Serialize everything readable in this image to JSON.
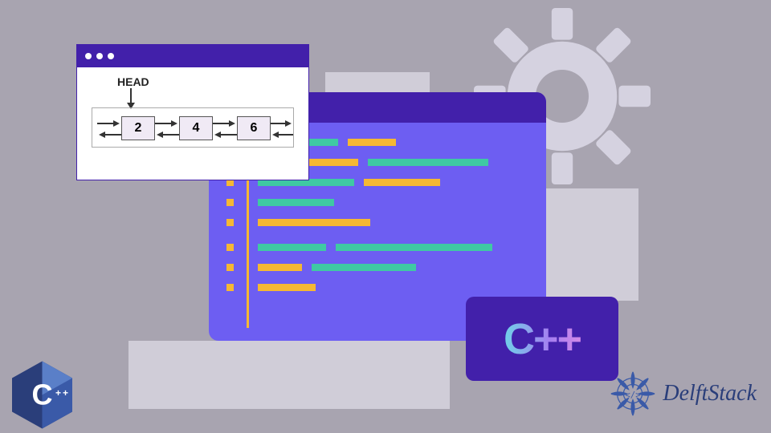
{
  "diagram": {
    "head_label": "HEAD",
    "nodes": [
      "2",
      "4",
      "6"
    ]
  },
  "cpp_badge": "C++",
  "brand": "DelftStack",
  "colors": {
    "bg": "#a8a4b0",
    "purple_dark": "#4220aa",
    "purple": "#6d5ef2",
    "orange": "#f5b833",
    "teal": "#3fc9a3"
  }
}
